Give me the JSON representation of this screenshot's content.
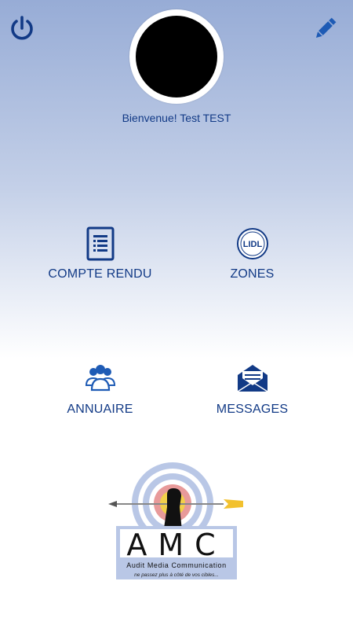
{
  "header": {
    "power_icon": "power-icon",
    "edit_icon": "pencil-icon"
  },
  "profile": {
    "welcome": "Bienvenue! Test TEST"
  },
  "menu": {
    "compte_rendu": {
      "label": "COMPTE RENDU",
      "icon": "document-icon"
    },
    "zones": {
      "label": "ZONES",
      "icon": "lidl-logo-icon"
    },
    "annuaire": {
      "label": "ANNUAIRE",
      "icon": "users-icon"
    },
    "messages": {
      "label": "MESSAGES",
      "icon": "envelope-icon"
    }
  },
  "logo": {
    "brand": "AMC",
    "line1": "Audit Media Communication",
    "line2": "ne passez plus à côté de vos cibles..."
  },
  "colors": {
    "accent": "#123a86",
    "gradient_top": "#97acd6"
  }
}
